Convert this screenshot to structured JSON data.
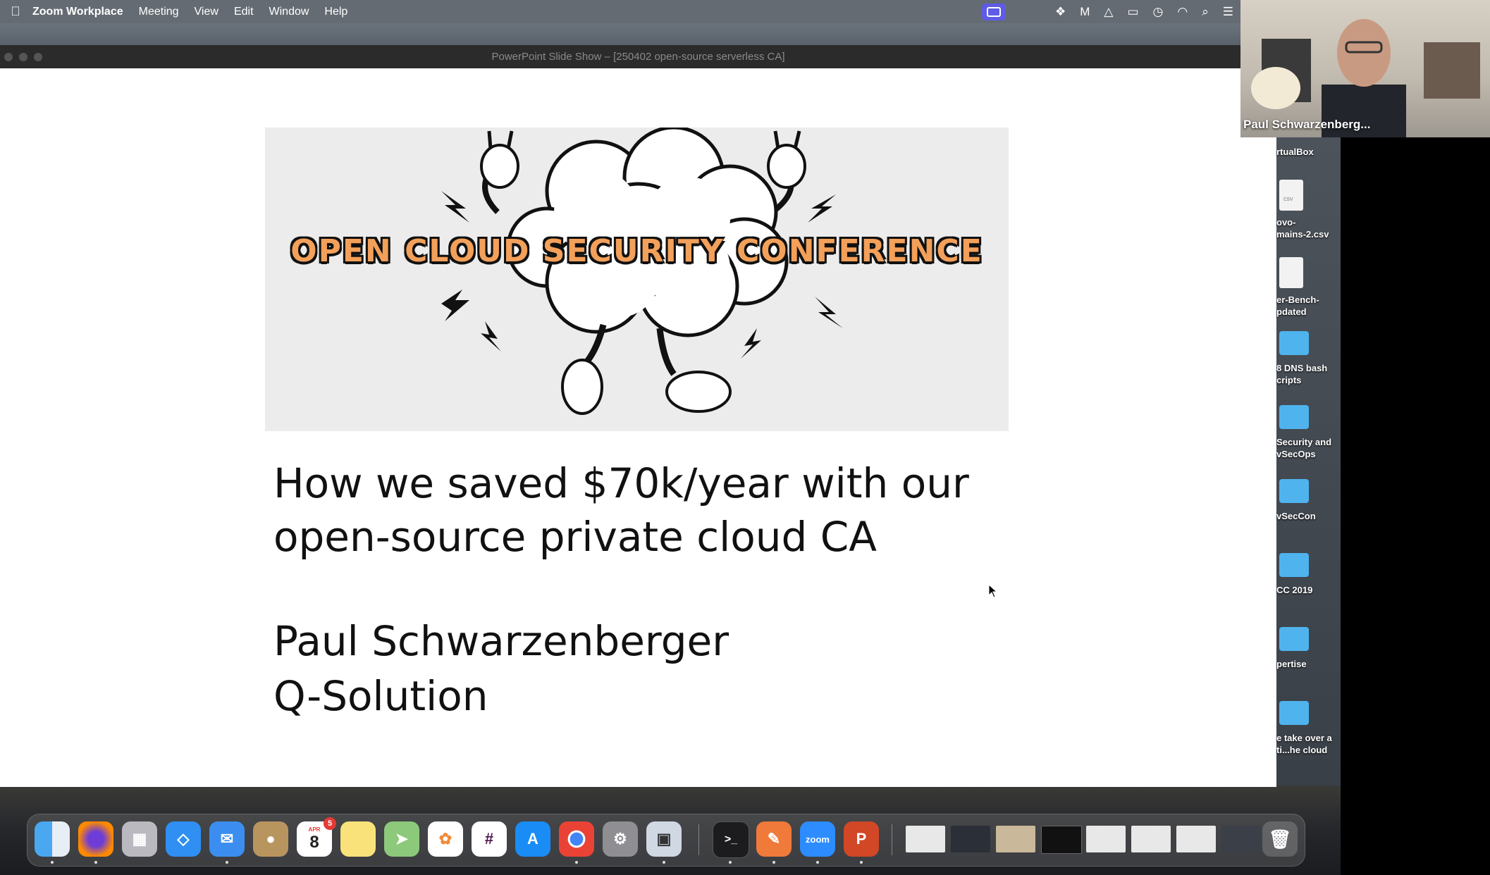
{
  "menubar": {
    "app_name": "Zoom Workplace",
    "items": [
      "Meeting",
      "View",
      "Edit",
      "Window",
      "Help"
    ]
  },
  "ppt_window": {
    "title": "PowerPoint Slide Show – [250402 open-source serverless CA]"
  },
  "slide": {
    "banner_text": "OPEN CLOUD SECURITY CONFERENCE",
    "title_line1": "How we saved $70k/year with our",
    "title_line2": "open-source private cloud CA",
    "speaker": "Paul Schwarzenberger",
    "company": "Q-Solution"
  },
  "video": {
    "participant_name": "Paul Schwarzenberg..."
  },
  "desktop_items": [
    {
      "label": "rtualBox",
      "kind": "none"
    },
    {
      "label": "ovo-\nmains-2.csv",
      "kind": "csv"
    },
    {
      "label": "er-Bench-\npdated",
      "kind": "doc"
    },
    {
      "label": "8 DNS bash\ncripts",
      "kind": "folder"
    },
    {
      "label": "Security and\nvSecOps",
      "kind": "folder"
    },
    {
      "label": "vSecCon",
      "kind": "folder"
    },
    {
      "label": "CC 2019",
      "kind": "folder"
    },
    {
      "label": "pertise",
      "kind": "folder"
    },
    {
      "label": "e take over a\nti...he cloud",
      "kind": "folder"
    }
  ],
  "dock": {
    "calendar_month": "APR",
    "calendar_day": "8",
    "calendar_badge": "5",
    "zoom_label": "zoom",
    "icons": [
      "finder-icon",
      "firefox-icon",
      "launchpad-icon",
      "safari-icon",
      "mail-icon",
      "contacts-icon",
      "calendar-icon",
      "notes-icon",
      "maps-icon",
      "photos-icon",
      "slack-icon",
      "app-store-icon",
      "chrome-icon",
      "system-settings-icon",
      "preview-icon",
      "terminal-icon",
      "pen-app-icon",
      "zoom-icon",
      "powerpoint-icon",
      "trash-icon"
    ]
  },
  "colors": {
    "banner_text": "#f3a05a",
    "zoom_blue": "#2d8cff",
    "share_button": "#5e5ce6"
  }
}
